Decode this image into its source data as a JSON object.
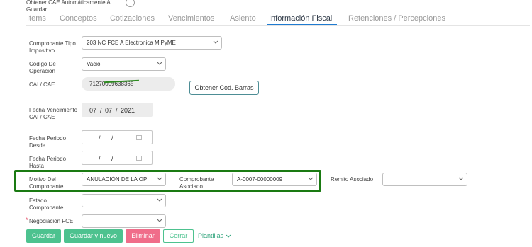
{
  "top_option": {
    "label": "Obtener CAE Automáticamente Al Guardar"
  },
  "tabs": [
    {
      "label": "Items"
    },
    {
      "label": "Conceptos"
    },
    {
      "label": "Cotizaciones"
    },
    {
      "label": "Vencimientos"
    },
    {
      "label": "Asiento"
    },
    {
      "label": "Información Fiscal"
    },
    {
      "label": "Retenciones / Percepciones"
    }
  ],
  "form": {
    "comprobante_tipo": {
      "label": "Comprobante Tipo Impositivo",
      "value": "203 NC FCE A Electronica MiPyME"
    },
    "codigo_operacion": {
      "label": "Codigo De Operación",
      "value": "Vacio"
    },
    "cai": {
      "label": "CAI / CAE",
      "value": "71270009638365"
    },
    "obtener_barras": {
      "label": "Obtener Cod. Barras"
    },
    "fecha_venc": {
      "label": "Fecha Vencimiento CAI / CAE",
      "day": "07",
      "month": "07",
      "year": "2021"
    },
    "fecha_desde": {
      "label": "Fecha Periodo Desde"
    },
    "fecha_hasta": {
      "label": "Fecha Periodo Hasta"
    },
    "motivo": {
      "label": "Motivo Del Comprobante",
      "value": "ANULACIÓN DE LA OP"
    },
    "comp_asociado": {
      "label": "Comprobante Asociado",
      "value": "A-0007-00000009"
    },
    "remito": {
      "label": "Remito Asociado",
      "value": ""
    },
    "estado": {
      "label": "Estado Comprobante",
      "value": ""
    },
    "negociacion": {
      "label": "Negociación FCE",
      "value": "",
      "required_mark": "*"
    }
  },
  "buttons": {
    "guardar": "Guardar",
    "guardar_nuevo": "Guardar y nuevo",
    "eliminar": "Eliminar",
    "cerrar": "Cerrar",
    "plantillas": "Plantillas"
  },
  "date_sep": "/",
  "colors": {
    "accent_tab": "#1f7bd1",
    "green_btn": "#4dc28f",
    "red_btn": "#f06d8a",
    "highlight_border": "#1a7a12"
  }
}
